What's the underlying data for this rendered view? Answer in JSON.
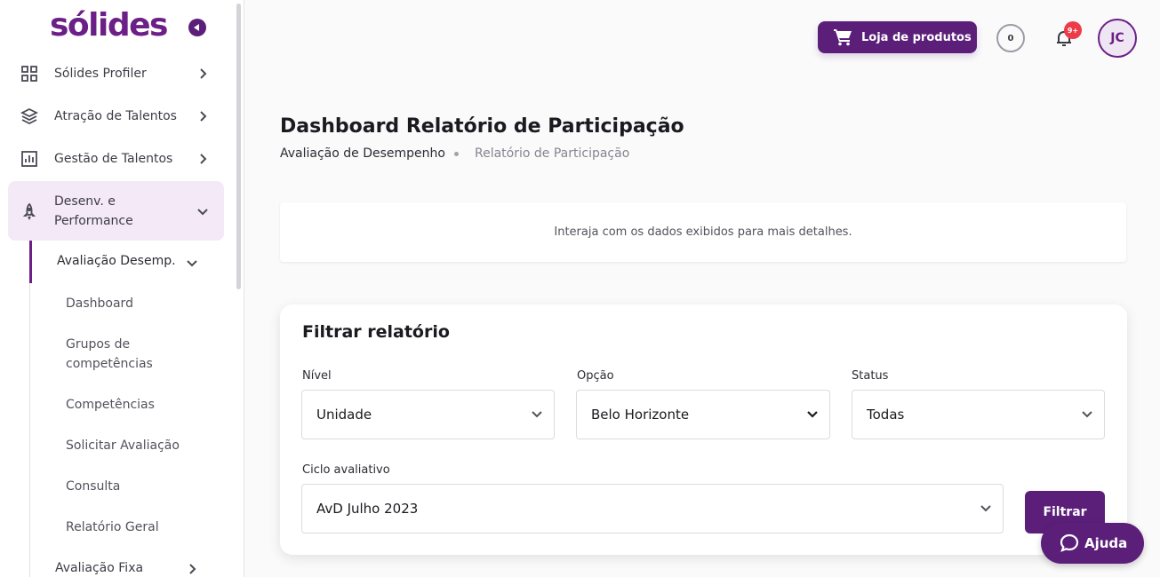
{
  "brand": {
    "logo_text": "sólides",
    "accent": "#5b1f7a"
  },
  "sidebar": {
    "items": [
      {
        "label": "Sólides Profiler",
        "icon": "grid-icon"
      },
      {
        "label": "Atração de Talentos",
        "icon": "layers-icon"
      },
      {
        "label": "Gestão de Talentos",
        "icon": "chart-icon"
      },
      {
        "label": "Desenv. e",
        "label2": "Performance",
        "icon": "rocket-icon"
      }
    ],
    "sub": {
      "label": "Avaliação Desemp.",
      "children": [
        {
          "label": "Dashboard"
        },
        {
          "label": "Grupos de",
          "label2": "competências"
        },
        {
          "label": "Competências"
        },
        {
          "label": "Solicitar Avaliação"
        },
        {
          "label": "Consulta"
        },
        {
          "label": "Relatório Geral"
        }
      ],
      "next": "Avaliação Fixa"
    }
  },
  "header": {
    "store_label": "Loja de produtos",
    "coins": "0",
    "notifications_badge": "9+",
    "avatar_initials": "JC"
  },
  "page": {
    "title": "Dashboard Relatório de Participação",
    "breadcrumb": [
      "Avaliação de Desempenho",
      "Relatório de Participação"
    ],
    "info_text": "Interaja com os dados exibidos para mais detalhes."
  },
  "filter": {
    "title": "Filtrar relatório",
    "nivel_label": "Nível",
    "nivel_value": "Unidade",
    "opcao_label": "Opção",
    "opcao_value": "Belo Horizonte",
    "status_label": "Status",
    "status_value": "Todas",
    "ciclo_label": "Ciclo avaliativo",
    "ciclo_value": "AvD Julho 2023",
    "button": "Filtrar"
  },
  "help": {
    "label": "Ajuda"
  }
}
